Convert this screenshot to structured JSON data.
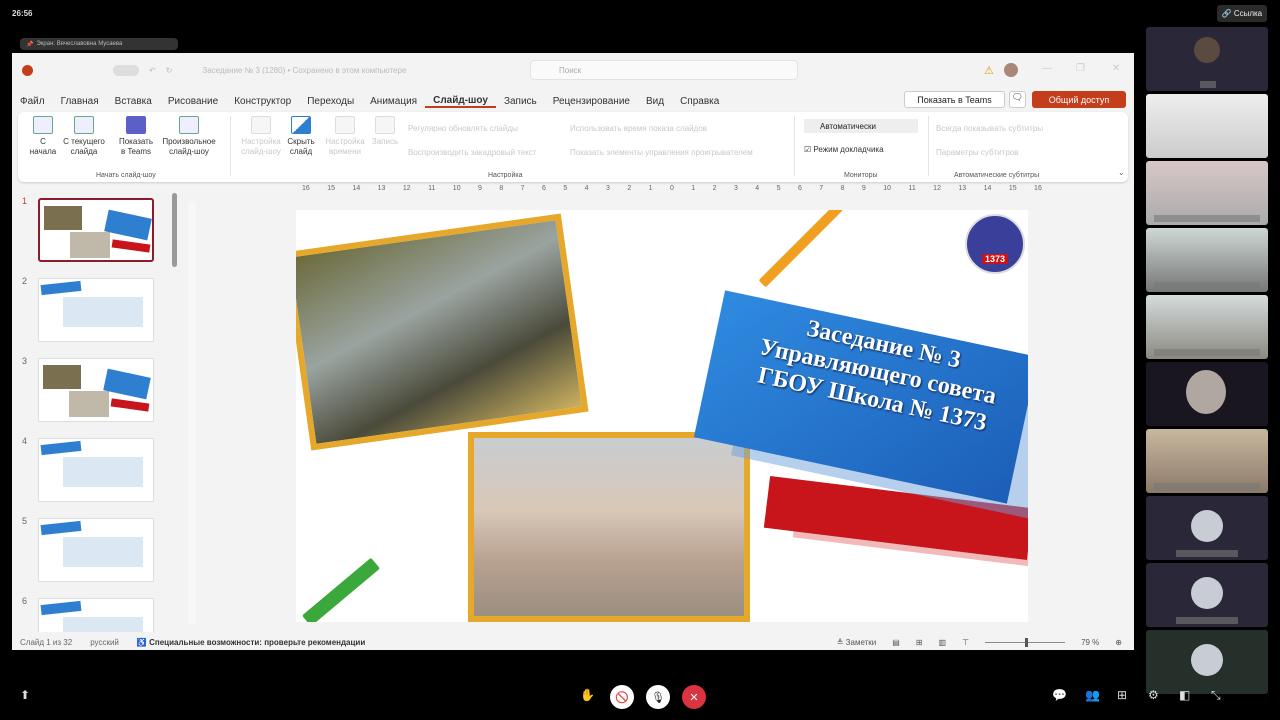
{
  "meeting": {
    "clock": "26:56",
    "link_label": "Ссылка",
    "presenter_tag": "Экран: Вячеславовна Мусаева"
  },
  "ppt": {
    "search_placeholder": "Поиск",
    "file_title": "Заседание № 3 (1280) • Сохранено в этом компьютере",
    "tabs": [
      "Файл",
      "Главная",
      "Вставка",
      "Рисование",
      "Конструктор",
      "Переходы",
      "Анимация",
      "Слайд-шоу",
      "Запись",
      "Рецензирование",
      "Вид",
      "Справка"
    ],
    "show_in_teams": "Показать в Teams",
    "share": "Общий доступ",
    "ribbon": {
      "from_start": "С начала",
      "from_current": "С текущего слайда",
      "show_teams": "Показать в Teams",
      "custom_show": "Произвольное слайд-шоу",
      "setup_show": "Настройка слайд-шоу",
      "hide_slide": "Скрыть слайд",
      "rehearse": "Настройка времени",
      "record": "Запись",
      "group_start": "Начать слайд-шоу",
      "group_setup": "Настройка",
      "group_monitors": "Мониторы",
      "group_captions": "Автоматические субтитры",
      "monitor_value": "Автоматически",
      "presenter_view": "Режим докладчика",
      "opt1": "Регулярно обновлять слайды",
      "opt2": "Воспроизводить закадровый текст",
      "opt3": "Использовать время показа слайдов",
      "opt4": "Показать элементы управления проигрывателем",
      "opt5": "Всегда показывать субтитры",
      "opt6": "Параметры субтитров"
    },
    "ruler": [
      "16",
      "15",
      "14",
      "13",
      "12",
      "11",
      "10",
      "9",
      "8",
      "7",
      "6",
      "5",
      "4",
      "3",
      "2",
      "1",
      "0",
      "1",
      "2",
      "3",
      "4",
      "5",
      "6",
      "7",
      "8",
      "9",
      "10",
      "11",
      "12",
      "13",
      "14",
      "15",
      "16"
    ],
    "thumbnails": [
      "1",
      "2",
      "3",
      "4",
      "5",
      "6"
    ],
    "slide": {
      "title_lines": [
        "Заседание № 3",
        "Управляющего совета",
        "ГБОУ Школа № 1373"
      ],
      "logo_text": "1373"
    },
    "status": {
      "slide_counter": "Слайд 1 из 32",
      "language": "русский",
      "accessibility": "Специальные возможности: проверьте рекомендации",
      "notes": "Заметки",
      "zoom": "79 %"
    }
  },
  "colors": {
    "accent": "#c43e1c",
    "blue": "#2f7fd0",
    "red": "#c8141b",
    "end_call": "#d9343f"
  }
}
